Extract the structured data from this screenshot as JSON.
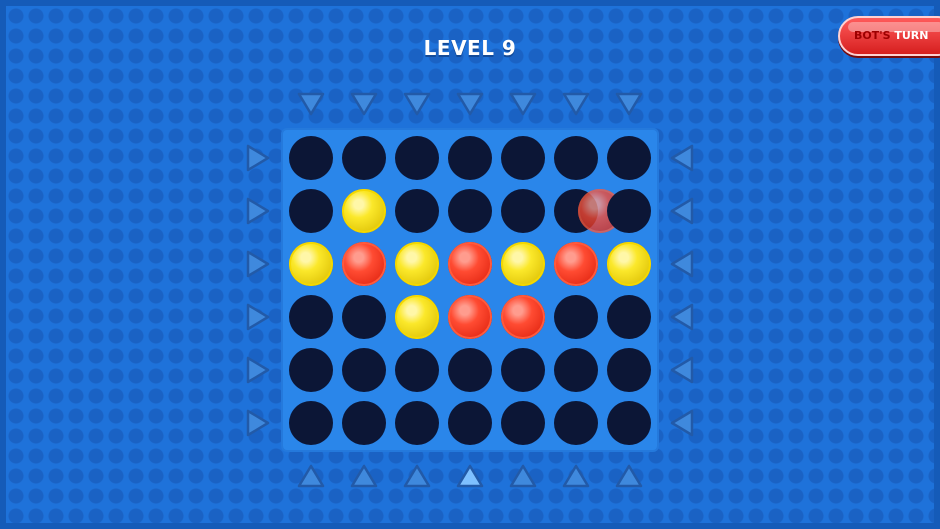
{
  "level_label": "LEVEL 9",
  "turn_indicator": {
    "who": "BOT'S",
    "what": "TURN"
  },
  "colors": {
    "background": "#1e72da",
    "board": "#2a86ea",
    "empty_slot": "#0c1636",
    "yellow_disc": "#fbe82a",
    "red_disc": "#ff4b32",
    "arrow": "#3f89dd",
    "arrow_active": "#7ec0ff"
  },
  "board": {
    "rows": 6,
    "cols": 7,
    "cells": [
      [
        "empty",
        "empty",
        "empty",
        "empty",
        "empty",
        "empty",
        "empty"
      ],
      [
        "empty",
        "yellow",
        "empty",
        "empty",
        "empty",
        "red-ghost",
        "empty"
      ],
      [
        "yellow",
        "red",
        "yellow",
        "red",
        "yellow",
        "red",
        "yellow"
      ],
      [
        "empty",
        "empty",
        "yellow",
        "red",
        "red",
        "empty",
        "empty"
      ],
      [
        "empty",
        "empty",
        "empty",
        "empty",
        "empty",
        "empty",
        "empty"
      ],
      [
        "empty",
        "empty",
        "empty",
        "empty",
        "empty",
        "empty",
        "empty"
      ]
    ]
  },
  "controls": {
    "top_arrows": {
      "count": 7,
      "icon": "arrow-down-icon"
    },
    "bottom_arrows": {
      "count": 7,
      "icon": "arrow-up-icon",
      "highlighted_index": 3
    },
    "left_arrows": {
      "count": 6,
      "icon": "arrow-right-icon"
    },
    "right_arrows": {
      "count": 6,
      "icon": "arrow-left-icon"
    }
  }
}
